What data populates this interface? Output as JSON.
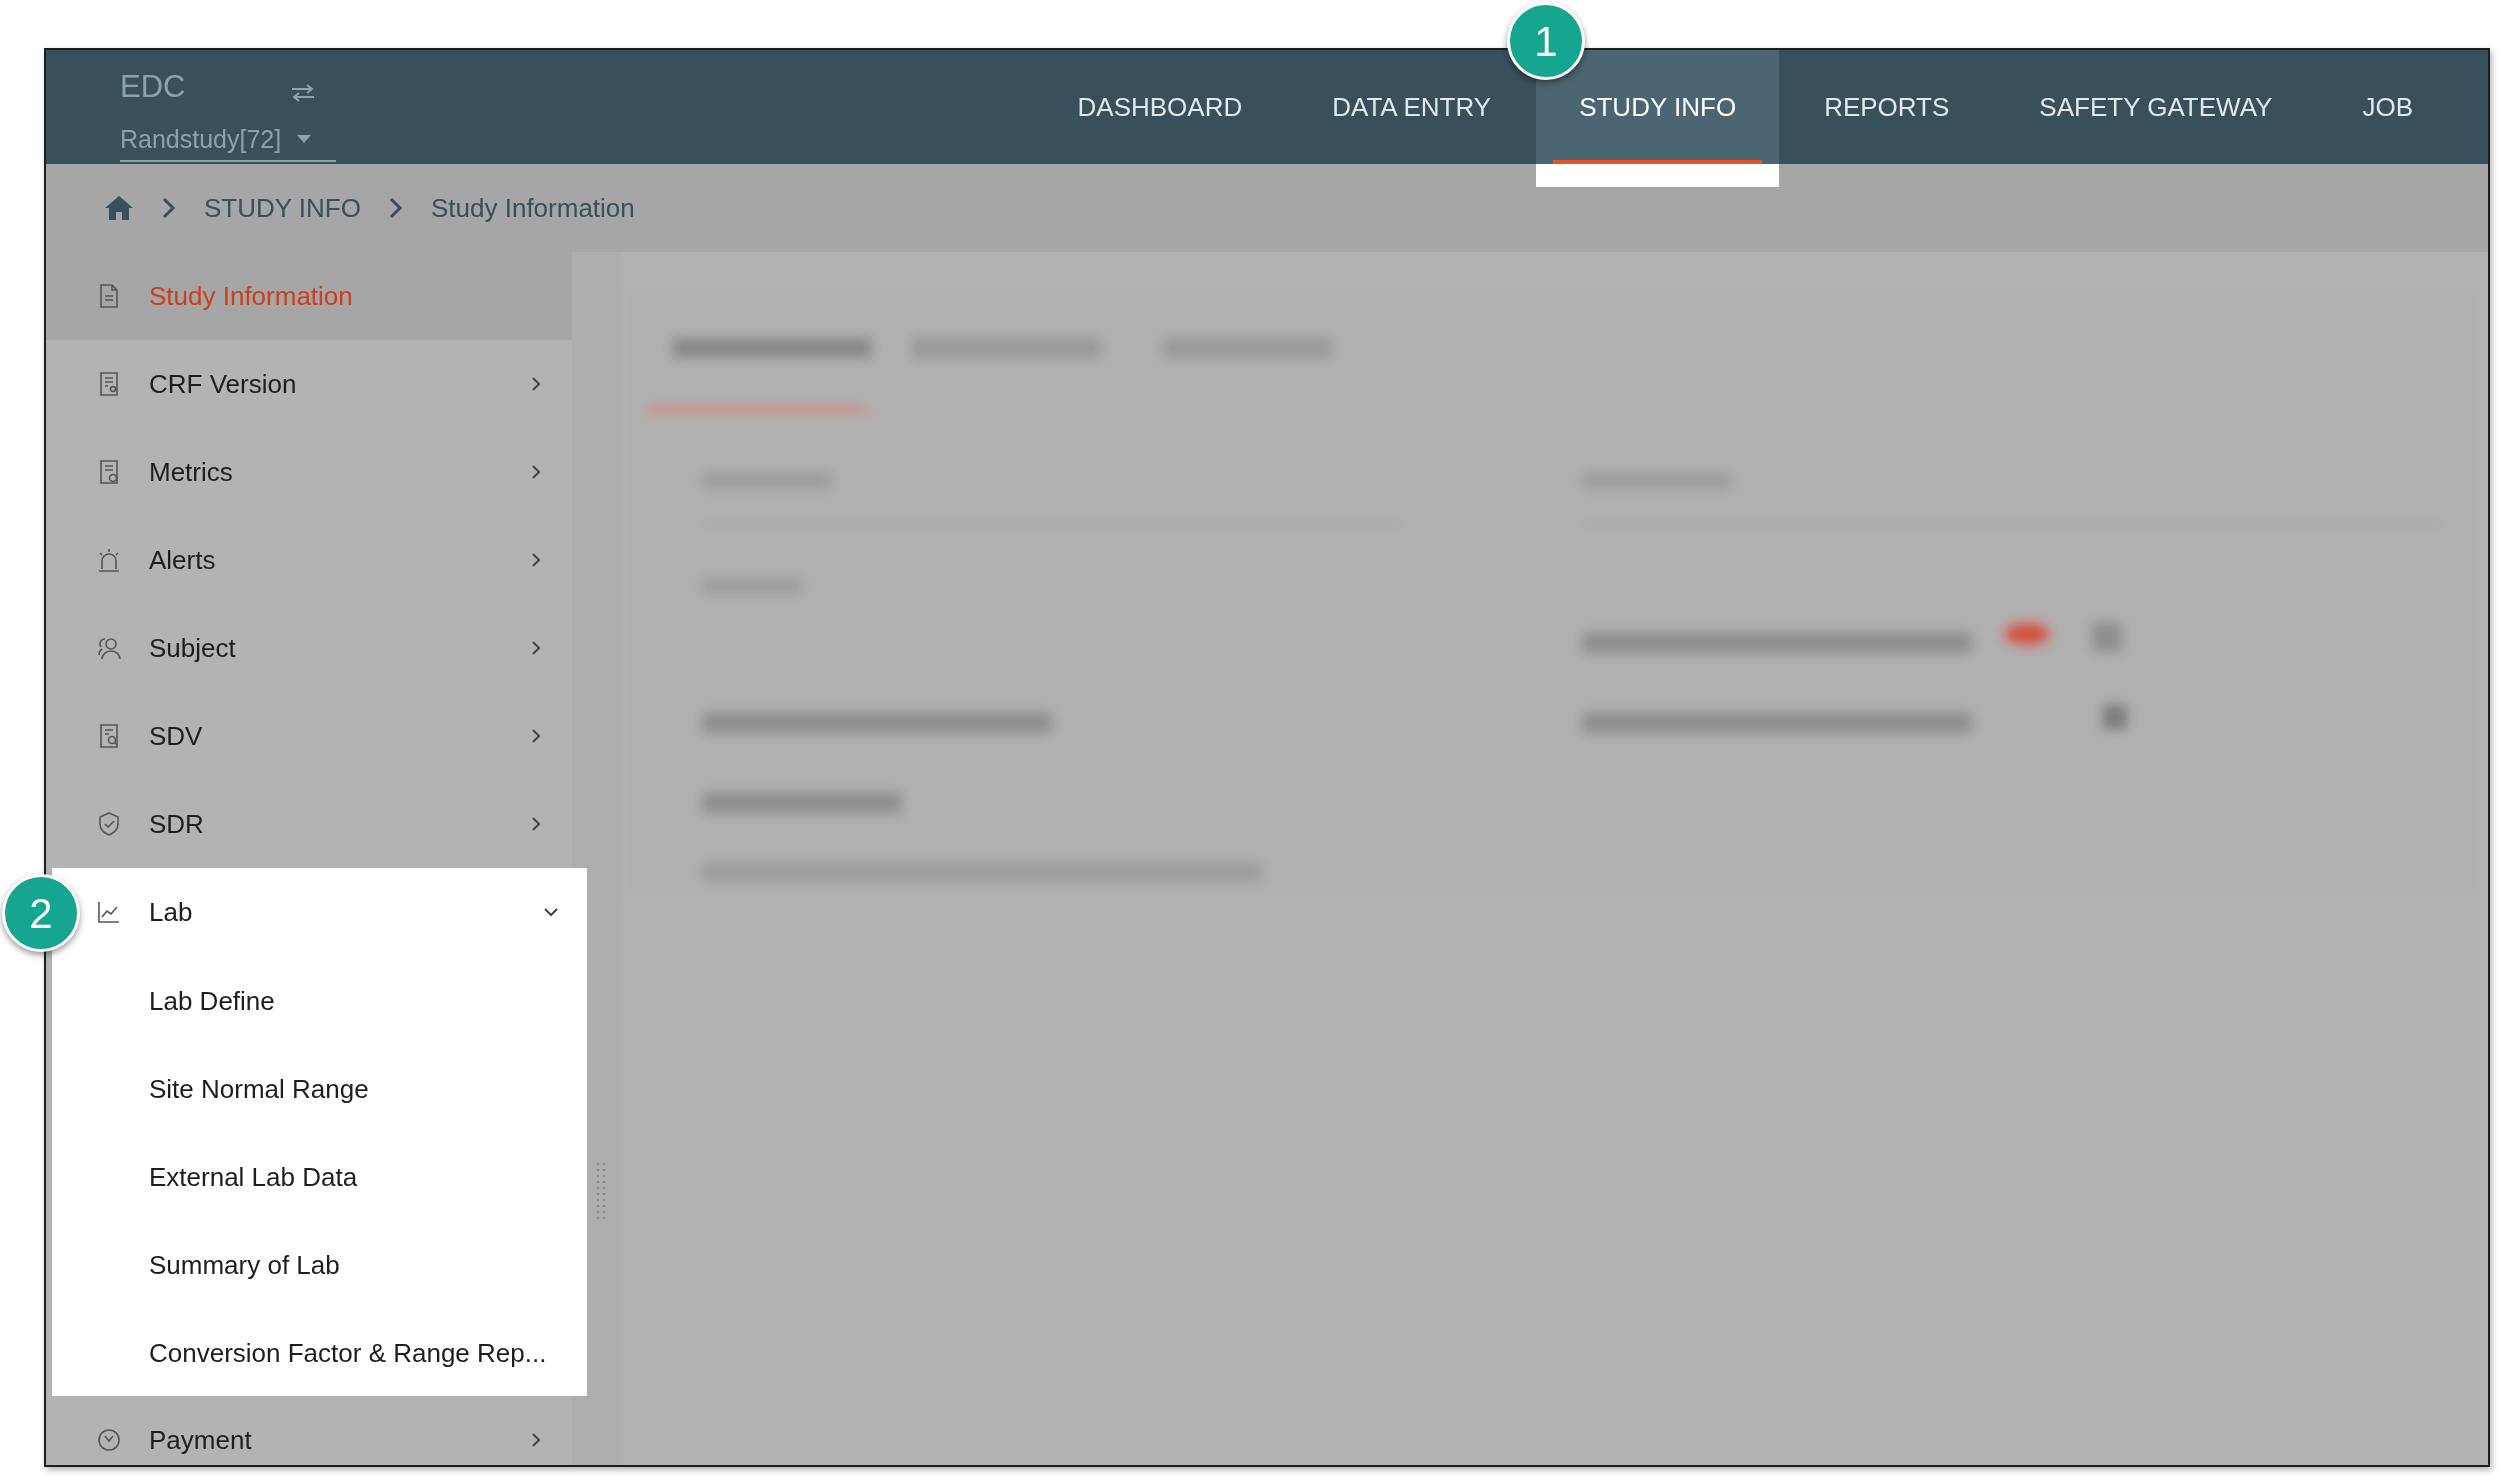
{
  "app": {
    "name": "EDC",
    "study": "Randstudy[72]"
  },
  "nav": [
    {
      "label": "DASHBOARD",
      "selected": false
    },
    {
      "label": "DATA ENTRY",
      "selected": false
    },
    {
      "label": "STUDY INFO",
      "selected": true
    },
    {
      "label": "REPORTS",
      "selected": false
    },
    {
      "label": "SAFETY GATEWAY",
      "selected": false
    },
    {
      "label": "JOB",
      "selected": false
    }
  ],
  "breadcrumb": [
    "STUDY INFO",
    "Study Information"
  ],
  "sidebar": {
    "items": [
      {
        "label": "Study Information",
        "kind": "link",
        "selected": true
      },
      {
        "label": "CRF Version",
        "kind": "group",
        "selected": false,
        "expanded": false
      },
      {
        "label": "Metrics",
        "kind": "group",
        "selected": false,
        "expanded": false
      },
      {
        "label": "Alerts",
        "kind": "group",
        "selected": false,
        "expanded": false
      },
      {
        "label": "Subject",
        "kind": "group",
        "selected": false,
        "expanded": false
      },
      {
        "label": "SDV",
        "kind": "group",
        "selected": false,
        "expanded": false
      },
      {
        "label": "SDR",
        "kind": "group",
        "selected": false,
        "expanded": false
      },
      {
        "label": "Lab",
        "kind": "group",
        "selected": false,
        "expanded": true,
        "children": [
          {
            "label": "Lab Define"
          },
          {
            "label": "Site Normal Range"
          },
          {
            "label": "External Lab Data"
          },
          {
            "label": "Summary of Lab"
          },
          {
            "label": "Conversion Factor & Range Rep..."
          }
        ]
      },
      {
        "label": "Payment",
        "kind": "group",
        "selected": false,
        "expanded": false
      }
    ]
  },
  "callouts": [
    "1",
    "2"
  ]
}
